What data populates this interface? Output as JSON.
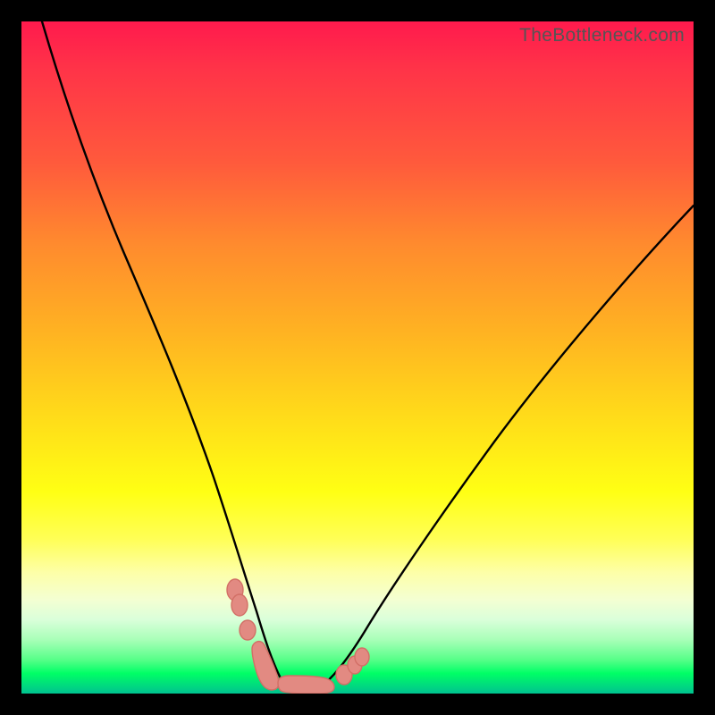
{
  "watermark": "TheBottleneck.com",
  "chart_data": {
    "type": "line",
    "title": "",
    "xlabel": "",
    "ylabel": "",
    "xlim": [
      0,
      100
    ],
    "ylim": [
      0,
      100
    ],
    "grid": false,
    "legend": false,
    "series": [
      {
        "name": "curve",
        "x": [
          3,
          6,
          10,
          14,
          18,
          22,
          25,
          28,
          30,
          31.5,
          33,
          34.3,
          35,
          36,
          37.5,
          39,
          41,
          43,
          45,
          47.5,
          51,
          56,
          62,
          70,
          80,
          92,
          100
        ],
        "y": [
          100,
          90,
          78,
          66,
          55,
          44,
          35,
          26,
          19,
          13.5,
          9,
          5.2,
          3.4,
          2.0,
          1.0,
          0.4,
          0.1,
          0.15,
          0.7,
          2.0,
          5.3,
          11.5,
          19.5,
          29.5,
          41,
          53,
          60
        ]
      }
    ],
    "markers": [
      {
        "name": "left-double-nodule",
        "x": 31.7,
        "y": 15.0
      },
      {
        "name": "left-double-nodule",
        "x": 32.3,
        "y": 13.0
      },
      {
        "name": "left-single-nodule",
        "x": 33.5,
        "y": 9.4
      },
      {
        "name": "left-bottom-blob",
        "x": 35.0,
        "y": 3.2
      },
      {
        "name": "flat-blob",
        "x": 40.0,
        "y": 0.3
      },
      {
        "name": "right-bottom-blob",
        "x": 45.0,
        "y": 0.7
      },
      {
        "name": "right-single-nodule",
        "x": 48.0,
        "y": 2.7
      },
      {
        "name": "right-double-nodule",
        "x": 49.6,
        "y": 4.2
      },
      {
        "name": "right-double-nodule",
        "x": 50.5,
        "y": 5.1
      }
    ],
    "gradient_stops": [
      {
        "pct": 0,
        "color": "#ff1a4d"
      },
      {
        "pct": 35,
        "color": "#ff8a2e"
      },
      {
        "pct": 70,
        "color": "#ffff14"
      },
      {
        "pct": 100,
        "color": "#00c290"
      }
    ]
  }
}
